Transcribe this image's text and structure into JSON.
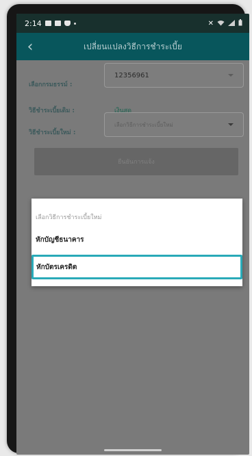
{
  "status_bar": {
    "time": "2:14",
    "left_icons": [
      "gallery-icon",
      "message-icon",
      "shield-icon"
    ],
    "right_icons": [
      "mute-icon",
      "wifi-icon",
      "signal-icon",
      "battery-icon"
    ]
  },
  "app_bar": {
    "back_glyph": "‹",
    "title": "เปลี่ยนแปลงวิธีการชำระเบี้ย"
  },
  "form": {
    "policy_label": "เลือกกรมธรรม์ :",
    "policy_value": "12356961",
    "current_method_label": "วิธีชำระเบี้ยเดิม :",
    "current_method_value": "เงินสด",
    "new_method_label": "วิธีชำระเบี้ยใหม่ :",
    "new_method_placeholder": "เลือกวิธีการชำระเบี้ยใหม่",
    "submit_label": "ยืนยันการแจ้ง"
  },
  "dialog": {
    "title": "เลือกวิธีการชำระเบี้ยใหม่",
    "options": [
      {
        "label": "หักบัญชีธนาคาร",
        "selected": false
      },
      {
        "label": "หักบัตรเครดิต",
        "selected": true
      }
    ]
  },
  "colors": {
    "app_bar": "#08565c",
    "status_bar": "#18302d",
    "highlight_border": "#29aab8",
    "dim_overlay": "#7a7a7a"
  }
}
